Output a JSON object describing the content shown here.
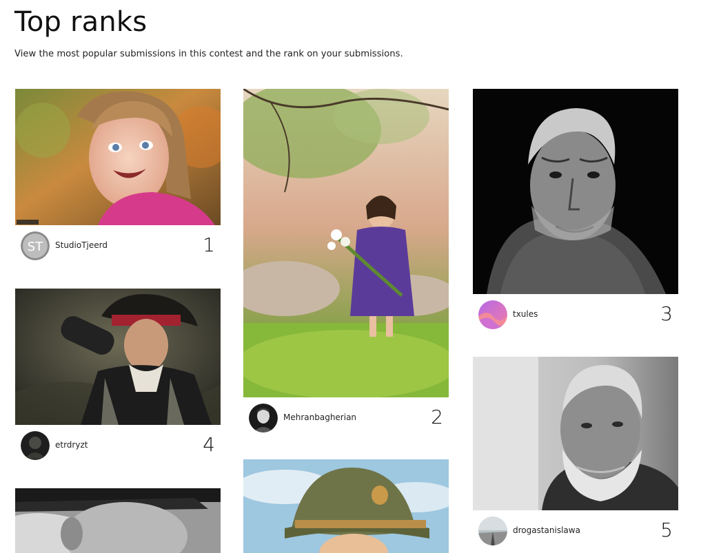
{
  "header": {
    "title": "Top ranks",
    "subtitle": "View the most popular submissions in this contest and the rank on your submissions."
  },
  "submissions": [
    {
      "rank": "1",
      "username": "StudioTjeerd",
      "avatar_initials": "ST"
    },
    {
      "rank": "2",
      "username": "Mehranbagherian"
    },
    {
      "rank": "3",
      "username": "txules"
    },
    {
      "rank": "4",
      "username": "etrdryzt"
    },
    {
      "rank": "5",
      "username": "drogastanislawa"
    }
  ],
  "colors": {
    "background": "#ffffff",
    "text": "#111111"
  }
}
